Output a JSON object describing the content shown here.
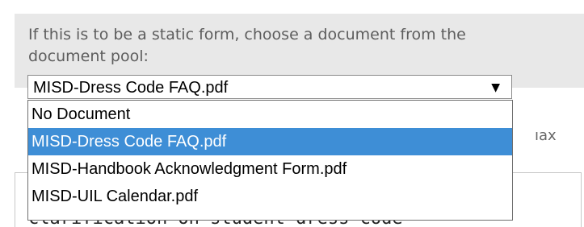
{
  "form": {
    "instruction": "If this is to be a static form, choose a document from the\ndocument pool:",
    "document_select": {
      "selected_value": "MISD-Dress Code FAQ.pdf",
      "arrow_icon": "dropdown-triangle-icon",
      "options": [
        "No Document",
        "MISD-Dress Code FAQ.pdf",
        "MISD-Handbook Acknowledgment Form.pdf",
        "MISD-UIL Calendar.pdf"
      ],
      "highlighted_index": 1
    },
    "partial_label": "ıax",
    "textarea_partial_text": "clarification on student dress code"
  },
  "colors": {
    "panel_background": "#e8e8e8",
    "highlight": "#3e8ed6",
    "label_text": "#5d5d5d"
  }
}
